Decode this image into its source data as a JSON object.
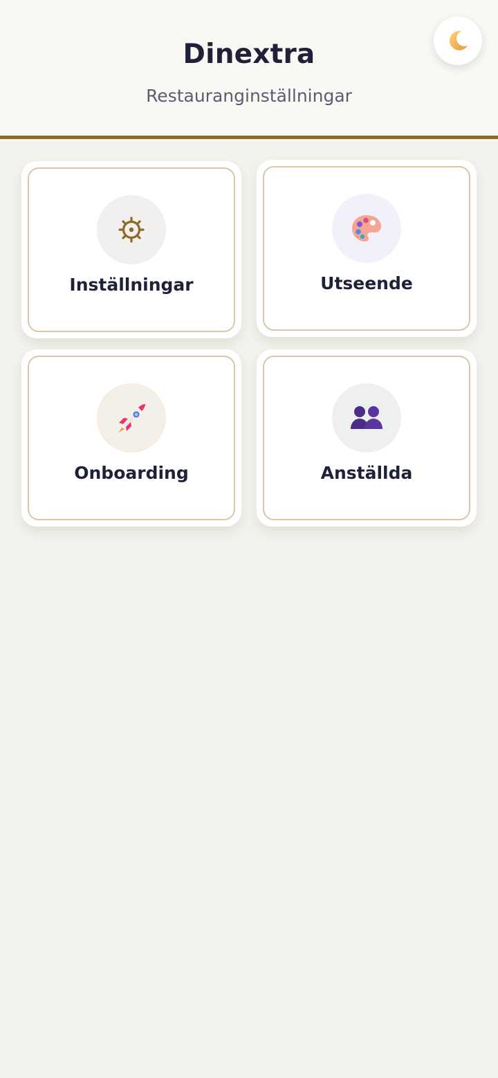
{
  "header": {
    "title": "Dinextra",
    "subtitle": "Restauranginställningar",
    "theme_toggle_icon": "moon-icon",
    "accent_color": "#8b6a26"
  },
  "cards": [
    {
      "label": "Inställningar",
      "icon": "gear-icon"
    },
    {
      "label": "Utseende",
      "icon": "palette-icon"
    },
    {
      "label": "Onboarding",
      "icon": "rocket-icon"
    },
    {
      "label": "Anställda",
      "icon": "people-icon"
    }
  ]
}
